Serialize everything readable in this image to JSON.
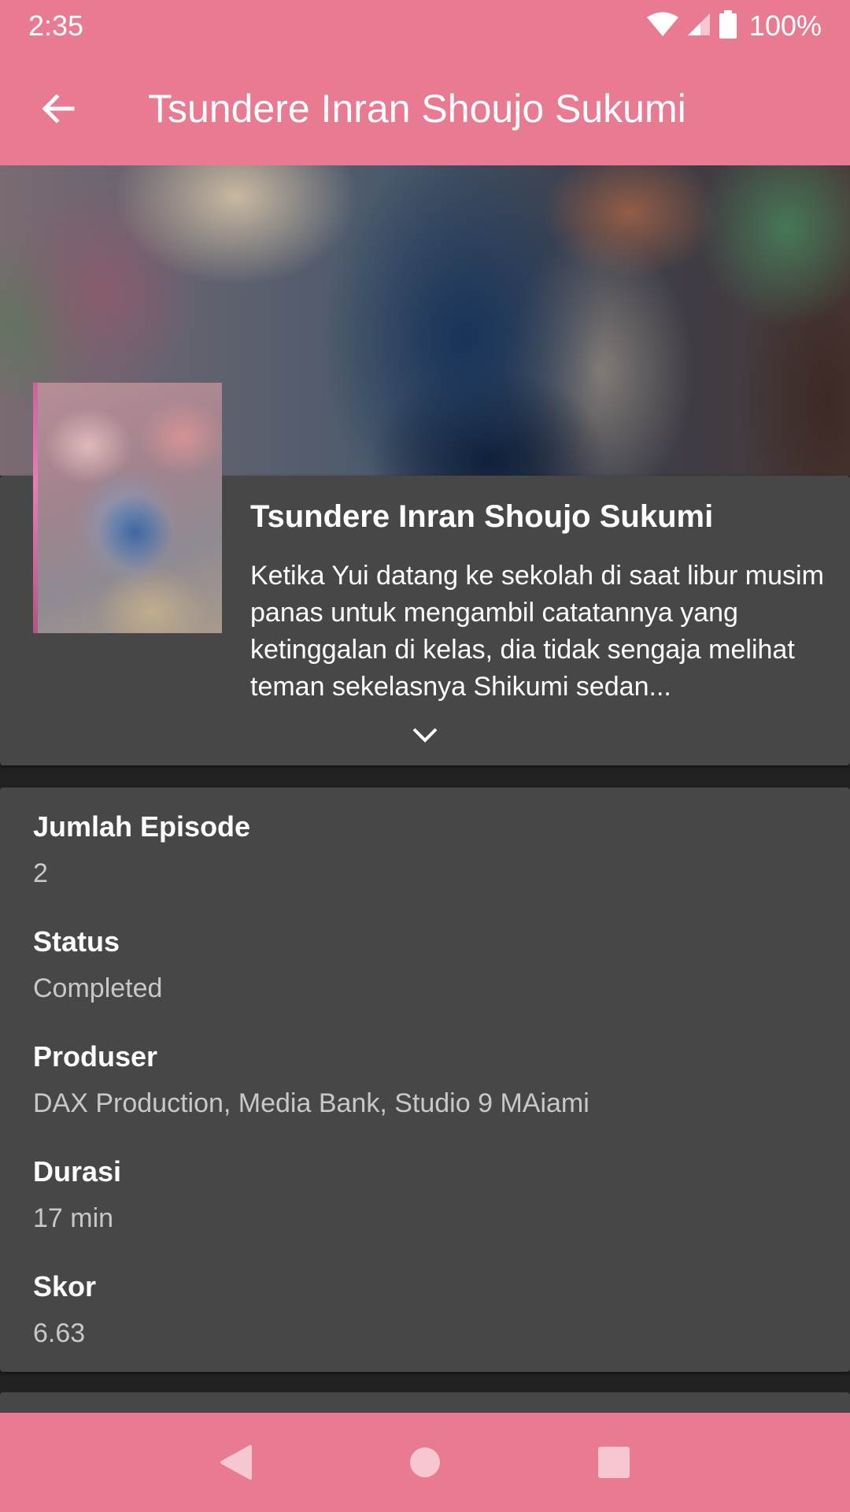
{
  "status_bar": {
    "time": "2:35",
    "battery": "100%"
  },
  "app_bar": {
    "title": "Tsundere Inran Shoujo Sukumi"
  },
  "info": {
    "title": "Tsundere Inran Shoujo Sukumi",
    "synopsis": "Ketika Yui datang ke sekolah di saat libur musim panas untuk mengambil catatannya yang ketinggalan di kelas, dia tidak sengaja melihat teman sekelasnya Shikumi sedan..."
  },
  "details": [
    {
      "label": "Jumlah Episode",
      "value": "2"
    },
    {
      "label": "Status",
      "value": "Completed"
    },
    {
      "label": "Produser",
      "value": "DAX Production, Media Bank, Studio 9 MAiami"
    },
    {
      "label": "Durasi",
      "value": "17 min"
    },
    {
      "label": "Skor",
      "value": "6.63"
    }
  ],
  "colors": {
    "accent": "#e87a92",
    "card": "#474747",
    "background": "#222222"
  }
}
